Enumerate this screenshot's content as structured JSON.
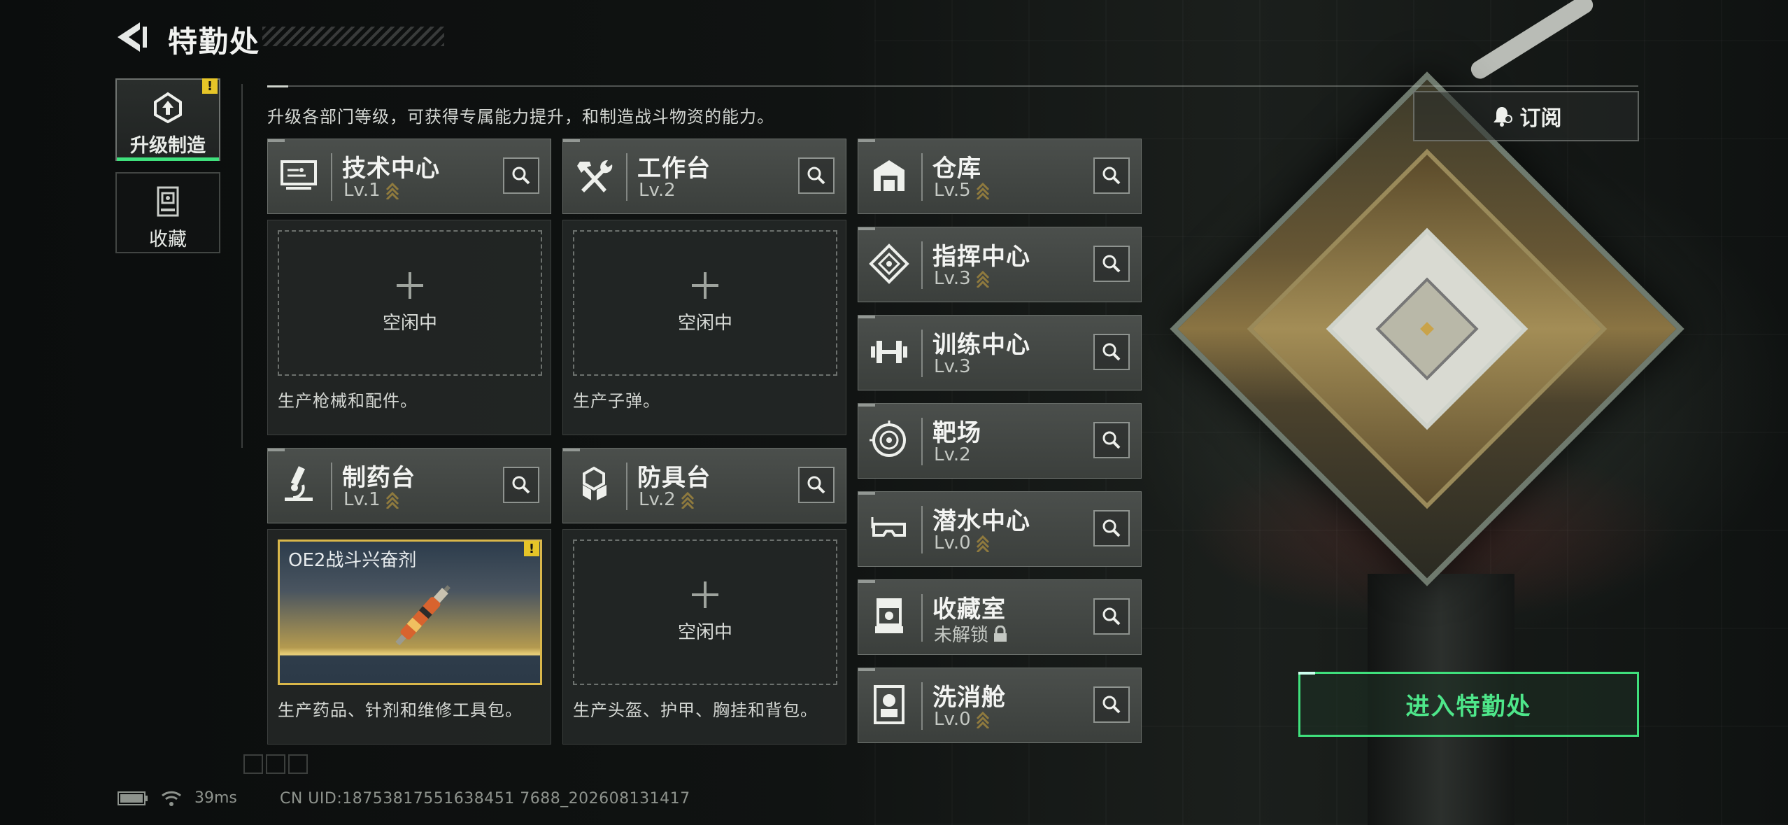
{
  "header": {
    "title": "特勤处"
  },
  "nav": {
    "items": [
      {
        "label": "升级制造",
        "icon": "upgrade-icon",
        "active": true,
        "alert": "!"
      },
      {
        "label": "收藏",
        "icon": "collection-icon",
        "active": false
      }
    ]
  },
  "description": "升级各部门等级，可获得专属能力提升，和制造战斗物资的能力。",
  "subscribe": {
    "label": "订阅",
    "icon": "bell-icon"
  },
  "production": [
    {
      "name": "技术中心",
      "level": "Lv.1",
      "icon": "computer-icon",
      "slot_status": "空闲中",
      "desc": "生产枪械和配件。"
    },
    {
      "name": "工作台",
      "level": "Lv.2",
      "icon": "hammer-wrench-icon",
      "slot_status": "空闲中",
      "desc": "生产子弹。"
    },
    {
      "name": "制药台",
      "level": "Lv.1",
      "icon": "microscope-icon",
      "product": "OE2战斗兴奋剂",
      "alert": "!",
      "desc": "生产药品、针剂和维修工具包。"
    },
    {
      "name": "防具台",
      "level": "Lv.2",
      "icon": "armor-blocks-icon",
      "slot_status": "空闲中",
      "desc": "生产头盔、护甲、胸挂和背包。"
    }
  ],
  "facilities": [
    {
      "name": "仓库",
      "level": "Lv.5",
      "icon": "warehouse-icon"
    },
    {
      "name": "指挥中心",
      "level": "Lv.3",
      "icon": "command-icon"
    },
    {
      "name": "训练中心",
      "level": "Lv.3",
      "icon": "dumbbell-icon"
    },
    {
      "name": "靶场",
      "level": "Lv.2",
      "icon": "target-icon"
    },
    {
      "name": "潜水中心",
      "level": "Lv.0",
      "icon": "diving-mask-icon"
    },
    {
      "name": "收藏室",
      "level": "未解锁",
      "icon": "display-case-icon",
      "locked": true
    },
    {
      "name": "洗消舱",
      "level": "Lv.0",
      "icon": "decon-icon"
    }
  ],
  "enter_button": "进入特勤处",
  "status": {
    "ping": "39ms",
    "uid": "CN UID:18753817551638451 7688_202608131417"
  }
}
